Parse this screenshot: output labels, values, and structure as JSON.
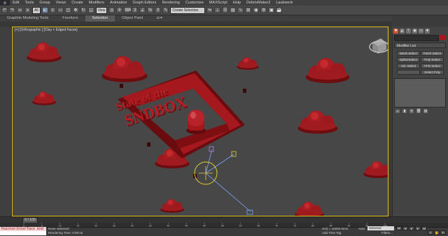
{
  "menubar": {
    "items": [
      "Edit",
      "Tools",
      "Group",
      "Views",
      "Create",
      "Modifiers",
      "Animation",
      "Graph Editors",
      "Rendering",
      "Customize",
      "MAXScript",
      "Help",
      "DebrisMaker2",
      "Laubwerk"
    ]
  },
  "toolbar": {
    "selection_filter": "All",
    "viewport_menu": "View",
    "named_selection_placeholder": "Create Selection Se"
  },
  "ribbon": {
    "tabs": [
      "Graphite Modeling Tools",
      "Freeform",
      "Selection",
      "Object Paint"
    ],
    "active_tab": "Selection"
  },
  "viewport": {
    "label": "[+] [Orthographic ] [Clay + Edged Faces]",
    "scene_text_line1": "State of the",
    "scene_text_line2": "SNDBOX"
  },
  "command_panel": {
    "modifier_list": "Modifier List",
    "buttons": [
      "Mesh Select",
      "Patch Select",
      "SplineSelect",
      "Poly Select",
      "Vol. Select",
      "FFD Select",
      "",
      "Select Poly"
    ]
  },
  "timeline": {
    "slider": "0 / 100",
    "ticks": [
      "0",
      "5",
      "10",
      "15",
      "20",
      "25",
      "30",
      "35",
      "40",
      "45",
      "50",
      "55",
      "60",
      "65",
      "70",
      "75",
      "80",
      "85",
      "90",
      "95",
      "100"
    ]
  },
  "status": {
    "listener": "PainterInterface End",
    "selected": "None Selected",
    "render_time": "Rendering Time: 0:00:16",
    "grid": "Grid = 10000.0mm",
    "add_time_tag": "Add Time Tag",
    "auto_key": "Auto",
    "selection_set": "Selected",
    "filters": "Filters..."
  }
}
